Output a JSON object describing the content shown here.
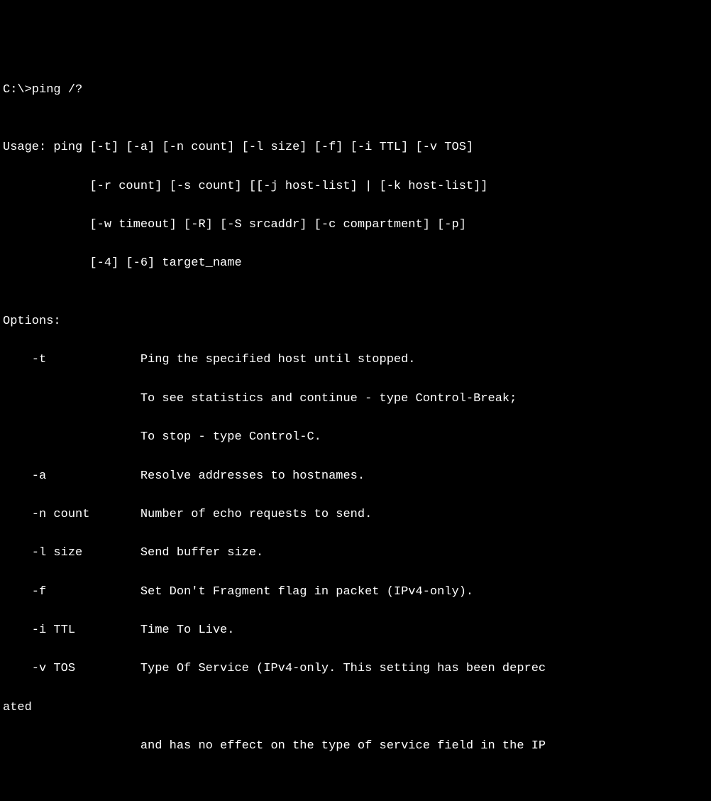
{
  "terminal": {
    "command_line": "C:\\>ping /?",
    "blank1": "",
    "usage1": "Usage: ping [-t] [-a] [-n count] [-l size] [-f] [-i TTL] [-v TOS]",
    "usage2": "            [-r count] [-s count] [[-j host-list] | [-k host-list]]",
    "usage3": "            [-w timeout] [-R] [-S srcaddr] [-c compartment] [-p]",
    "usage4": "            [-4] [-6] target_name",
    "blank2": "",
    "options_header": "Options:",
    "opt_t1": "    -t             Ping the specified host until stopped.",
    "opt_t2": "                   To see statistics and continue - type Control-Break;",
    "opt_t3": "                   To stop - type Control-C.",
    "opt_a": "    -a             Resolve addresses to hostnames.",
    "opt_n": "    -n count       Number of echo requests to send.",
    "opt_l": "    -l size        Send buffer size.",
    "opt_f": "    -f             Set Don't Fragment flag in packet (IPv4-only).",
    "opt_i": "    -i TTL         Time To Live.",
    "opt_v1": "    -v TOS         Type Of Service (IPv4-only. This setting has been deprec",
    "opt_v1b": "ated",
    "opt_v2": "                   and has no effect on the type of service field in the IP"
  }
}
